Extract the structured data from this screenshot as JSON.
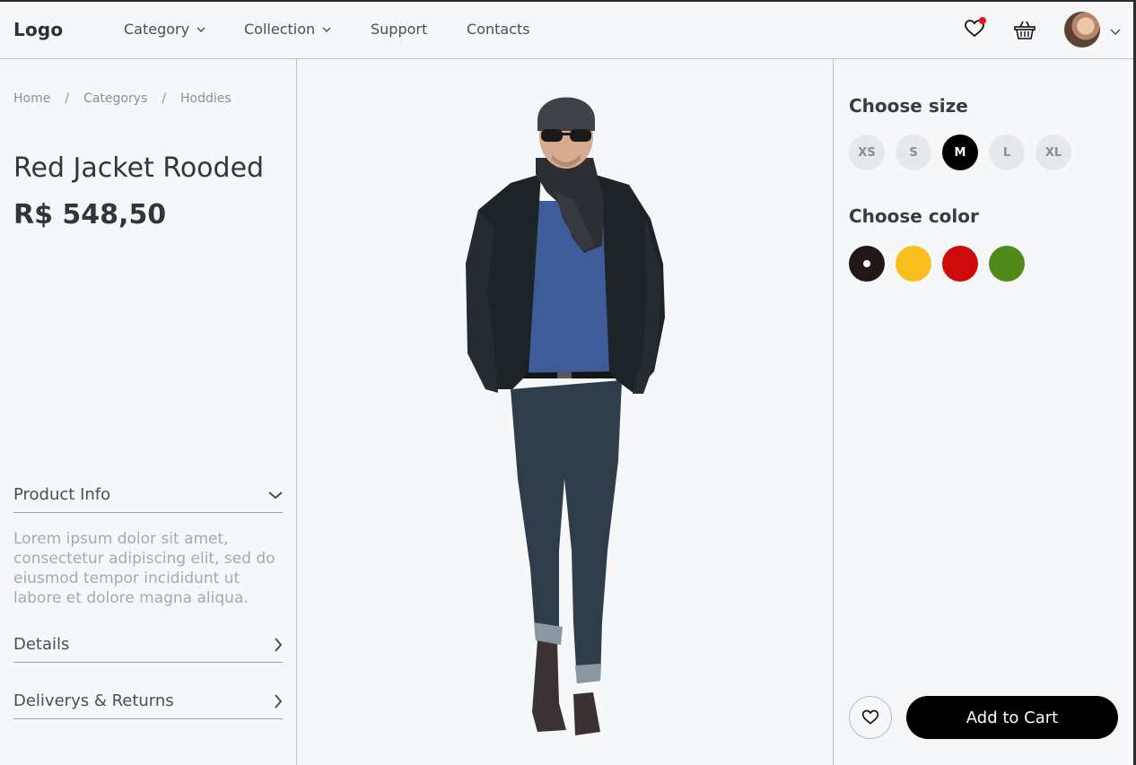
{
  "header": {
    "logo": "Logo",
    "nav": [
      {
        "label": "Category",
        "has_dropdown": true
      },
      {
        "label": "Collection",
        "has_dropdown": true
      },
      {
        "label": "Support",
        "has_dropdown": false
      },
      {
        "label": "Contacts",
        "has_dropdown": false
      }
    ],
    "icons": [
      "heart-icon",
      "basket-icon",
      "avatar",
      "chevron-down-icon"
    ],
    "wishlist_has_notification": true,
    "notification_color": "#e8121b"
  },
  "breadcrumb": [
    "Home",
    "Categorys",
    "Hoddies"
  ],
  "product": {
    "title": "Red Jacket Rooded",
    "price": "R$ 548,50"
  },
  "accordion": {
    "product_info": {
      "label": "Product Info",
      "expanded": true,
      "description": "Lorem ipsum dolor sit amet, consectetur adipiscing elit, sed do eiusmod tempor incididunt ut labore et dolore magna aliqua."
    },
    "details": {
      "label": "Details",
      "expanded": false
    },
    "delivery": {
      "label": "Deliverys & Returns",
      "expanded": false
    }
  },
  "options": {
    "size_title": "Choose size",
    "sizes": [
      "XS",
      "S",
      "M",
      "L",
      "XL"
    ],
    "selected_size": "M",
    "color_title": "Choose color",
    "colors": [
      "#231616",
      "#f7c01e",
      "#cf0a0a",
      "#4f8a1b"
    ],
    "selected_color_index": 0
  },
  "actions": {
    "add_to_cart": "Add to Cart"
  }
}
